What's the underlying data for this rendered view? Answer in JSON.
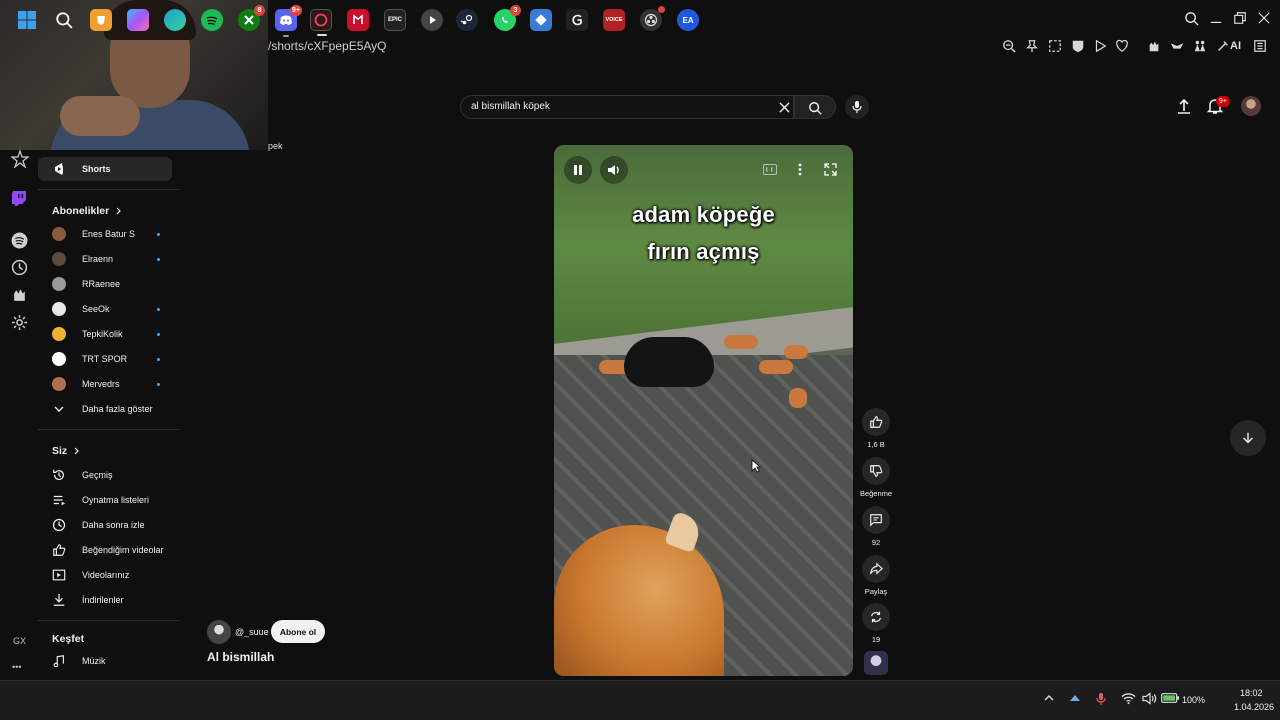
{
  "browser": {
    "url": "/shorts/cXFpepE5AyQ",
    "ai_label": "AI",
    "gx_label": "GX",
    "more_label": "•••"
  },
  "search": {
    "query": "al bismillah köpek",
    "partial_query": "pek"
  },
  "notifications": {
    "badge": "9+"
  },
  "sidebar": {
    "shorts_label": "Shorts",
    "subscriptions_heading": "Abonelikler",
    "subscriptions": [
      {
        "name": "Enes Batur S",
        "color": "#8a5a3c"
      },
      {
        "name": "Elraenn",
        "color": "#5a4a40"
      },
      {
        "name": "RRaenee",
        "color": "#9a9a9a"
      },
      {
        "name": "SeeOk",
        "color": "#e8e8e8"
      },
      {
        "name": "TepkiKolik",
        "color": "#f0b030"
      },
      {
        "name": "TRT SPOR",
        "color": "#ffffff"
      },
      {
        "name": "Mervedrs",
        "color": "#b07050"
      }
    ],
    "show_more_label": "Daha fazla göster",
    "you_heading": "Siz",
    "you_items": [
      {
        "label": "Geçmiş",
        "icon": "history-icon"
      },
      {
        "label": "Oynatma listeleri",
        "icon": "playlist-icon"
      },
      {
        "label": "Daha sonra izle",
        "icon": "clock-icon"
      },
      {
        "label": "Beğendiğim videolar",
        "icon": "thumb-up-icon"
      },
      {
        "label": "Videolarınız",
        "icon": "video-icon"
      },
      {
        "label": "İndirilenler",
        "icon": "download-icon"
      }
    ],
    "explore_heading": "Keşfet",
    "explore_items": [
      {
        "label": "Müzik",
        "icon": "music-icon"
      }
    ]
  },
  "video": {
    "caption_line1": "adam köpeğe",
    "caption_line2": "fırın açmış",
    "channel": "@_suue",
    "subscribe_label": "Abone ol",
    "title": "Al bismillah"
  },
  "actions": {
    "likes": "1,6 B",
    "dislike_label": "Beğenme",
    "comments": "92",
    "share_label": "Paylaş",
    "remix_count": "19"
  },
  "taskbar": {
    "apps": [
      {
        "name": "windows-start",
        "color": "#1e90ff"
      },
      {
        "name": "search",
        "color": "#1c1c1c"
      },
      {
        "name": "brave",
        "color": "#f0a030"
      },
      {
        "name": "copilot",
        "color": "#6a5cff"
      },
      {
        "name": "edge",
        "color": "#1fa0d0"
      },
      {
        "name": "spotify",
        "color": "#1db954"
      },
      {
        "name": "xbox",
        "color": "#107c10",
        "badge": "8"
      },
      {
        "name": "discord",
        "color": "#5865f2",
        "badge": "9+"
      },
      {
        "name": "opera-gx",
        "color": "#2a1a1a"
      },
      {
        "name": "mcafee",
        "color": "#c8102e"
      },
      {
        "name": "epic-games",
        "color": "#222222",
        "text": "EPIC"
      },
      {
        "name": "media-player",
        "color": "#444444"
      },
      {
        "name": "steam",
        "color": "#1b2838"
      },
      {
        "name": "whatsapp",
        "color": "#25d366",
        "badge": "3"
      },
      {
        "name": "app-blue",
        "color": "#3a7bd5"
      },
      {
        "name": "app-g",
        "color": "#222222"
      },
      {
        "name": "voicemeeter",
        "color": "#b22222",
        "text": "VOICE"
      },
      {
        "name": "obs",
        "color": "#333333"
      },
      {
        "name": "ea",
        "color": "#1e5ad8",
        "text": "EA"
      }
    ],
    "battery": "100%",
    "time": "18:02",
    "date": "1.04.2026"
  }
}
